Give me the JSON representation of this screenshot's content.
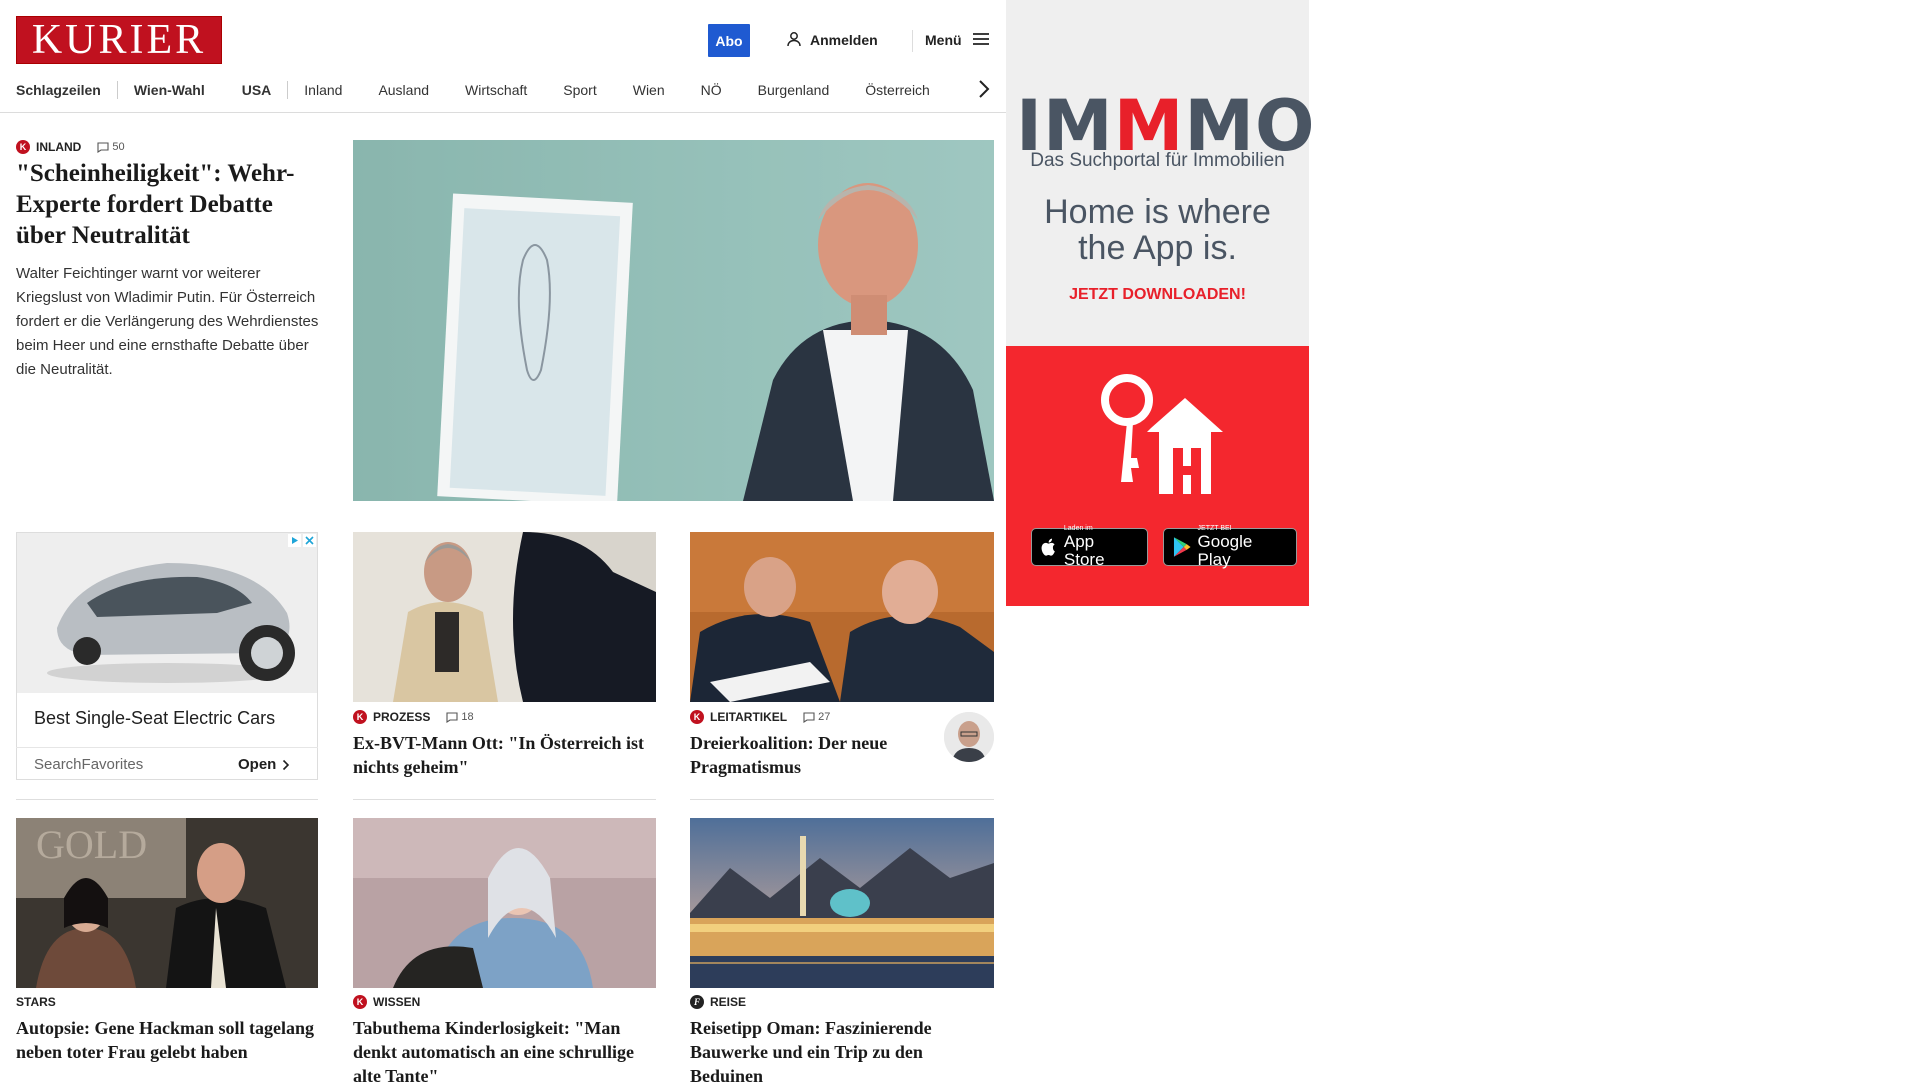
{
  "header": {
    "logo_text": "KURIER",
    "abo_label": "Abo",
    "login_label": "Anmelden",
    "menu_label": "Menü"
  },
  "nav": {
    "items": [
      "Schlagzeilen",
      "Wien-Wahl",
      "USA",
      "Inland",
      "Ausland",
      "Wirtschaft",
      "Sport",
      "Wien",
      "NÖ",
      "Burgenland",
      "Österreich"
    ]
  },
  "lead": {
    "kicker": "INLAND",
    "comments": "50",
    "title": "\"Scheinheiligkeit\": Wehr-Experte fordert Debatte über Neutralität",
    "teaser": "Walter Feichtinger warnt vor weiterer Kriegslust von Wladimir Putin. Für Österreich fordert er die Verlängerung des Wehrdienstes beim Heer und eine ernsthafte Debatte über die Neutralität."
  },
  "ad_card": {
    "title": "Best Single-Seat Electric Cars",
    "source": "SearchFavorites",
    "open_label": "Open"
  },
  "articles": [
    {
      "kicker": "PROZESS",
      "comments": "18",
      "title": "Ex-BVT-Mann Ott: \"In Österreich ist nichts geheim\""
    },
    {
      "kicker": "LEITARTIKEL",
      "comments": "27",
      "title": "Dreierkoalition: Der neue Pragmatismus"
    },
    {
      "kicker": "STARS",
      "title": "Autopsie: Gene Hackman soll tagelang neben toter Frau gelebt haben"
    },
    {
      "kicker": "WISSEN",
      "title": "Tabuthema Kinderlosigkeit: \"Man denkt automatisch an eine schrullige alte Tante\""
    },
    {
      "kicker": "REISE",
      "title": "Reisetipp Oman: Faszinierende Bauwerke und ein Trip zu den Beduinen"
    }
  ],
  "sidebar_ad": {
    "brand": "IMMMO",
    "tagline": "Das Suchportal für Immobilien",
    "slogan_line1": "Home is where",
    "slogan_line2": "the App is.",
    "cta": "JETZT DOWNLOADEN!",
    "appstore_small": "Laden im",
    "appstore_big": "App Store",
    "googleplay_small": "JETZT BEI",
    "googleplay_big": "Google Play"
  }
}
